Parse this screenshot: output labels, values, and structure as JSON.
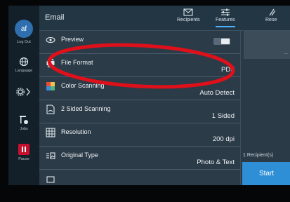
{
  "rail": {
    "avatar_initials": "af",
    "logout_label": "Log Out",
    "language_label": "Language",
    "jobs_label": "Jobs",
    "pause_label": "Pause"
  },
  "header": {
    "title": "Email",
    "recipients_label": "Recipients",
    "features_label": "Features",
    "reset_label": "Rese"
  },
  "features": [
    {
      "name": "Preview",
      "value": "",
      "icon": "eye-icon"
    },
    {
      "name": "File Format",
      "value": "PDF",
      "icon": "printer-file-icon"
    },
    {
      "name": "Color Scanning",
      "value": "Auto Detect",
      "icon": "color-icon"
    },
    {
      "name": "2 Sided Scanning",
      "value": "1 Sided",
      "icon": "two-sided-icon"
    },
    {
      "name": "Resolution",
      "value": "200 dpi",
      "icon": "grid-icon"
    },
    {
      "name": "Original Type",
      "value": "Photo & Text",
      "icon": "original-type-icon"
    }
  ],
  "right_pane": {
    "dots": "...",
    "recipient_count": "1 Recipient(s)",
    "start_label": "Start"
  },
  "colors": {
    "accent_blue": "#2f8fd6",
    "pause_red": "#c8102e",
    "annotation_red": "#e0101a"
  }
}
